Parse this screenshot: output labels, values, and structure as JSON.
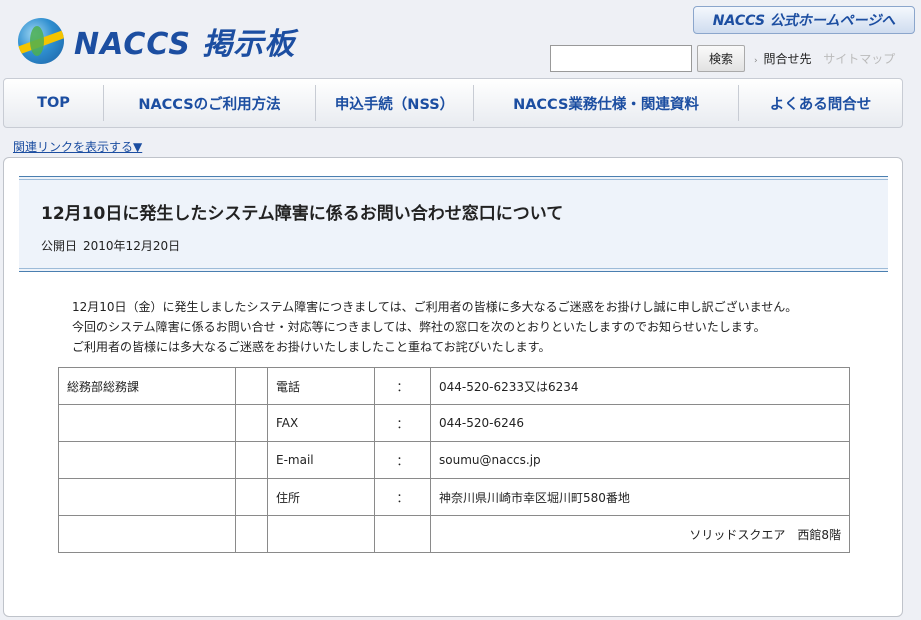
{
  "header": {
    "logo_text": "NACCS 掲示板",
    "homepage_link": "NACCS 公式ホームページへ",
    "search": {
      "placeholder": "",
      "value": "",
      "button_label": "検索"
    },
    "util_links": {
      "contact": "問合せ先",
      "sitemap": "サイトマップ"
    }
  },
  "nav": {
    "items": [
      {
        "label": "TOP"
      },
      {
        "label": "NACCSのご利用方法"
      },
      {
        "label": "申込手続（NSS）"
      },
      {
        "label": "NACCS業務仕様・関連資料"
      },
      {
        "label": "よくある問合せ"
      }
    ]
  },
  "related_link": "関連リンクを表示する▼",
  "article": {
    "title": "12月10日に発生したシステム障害に係るお問い合わせ窓口について",
    "date_label": "公開日",
    "date_value": "2010年12月20日",
    "paragraphs": [
      "12月10日（金）に発生しましたシステム障害につきましては、ご利用者の皆様に多大なるご迷惑をお掛けし誠に申し訳ございません。",
      "今回のシステム障害に係るお問い合せ・対応等につきましては、弊社の窓口を次のとおりといたしますのでお知らせいたします。",
      "ご利用者の皆様には多大なるご迷惑をお掛けいたしましたこと重ねてお詫びいたします。"
    ],
    "contact_table": {
      "department": "総務部総務課",
      "separator": "：",
      "rows": [
        {
          "label": "電話",
          "value": "044-520-6233又は6234"
        },
        {
          "label": "FAX",
          "value": "044-520-6246"
        },
        {
          "label": "E-mail",
          "value": "soumu@naccs.jp"
        },
        {
          "label": "住所",
          "value": "神奈川県川崎市幸区堀川町580番地"
        }
      ],
      "address_line2": "ソリッドスクエア　西館8階"
    }
  }
}
